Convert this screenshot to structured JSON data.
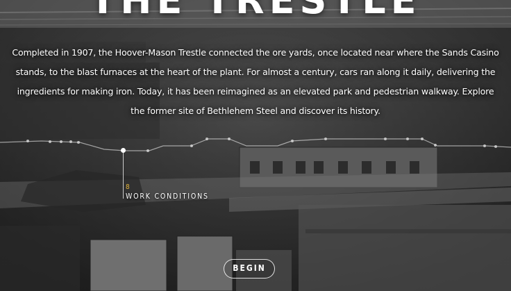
{
  "hero": {
    "title": "THE TRESTLE",
    "intro": "Completed in 1907, the Hoover-Mason Trestle connected the ore yards, once located near where the Sands Casino stands, to the blast furnaces at the heart of the plant. For almost a century, cars ran along it daily, delivering the ingredients for making iron. Today, it has been reimagined as an elevated park and pedestrian walkway. Explore the former site of Bethlehem Steel and discover its history."
  },
  "map_marker": {
    "number": "8",
    "label": "WORK CONDITIONS"
  },
  "begin_button": {
    "label": "BEGIN"
  },
  "colors": {
    "accent_number": "#e2b43a",
    "text": "#ffffff"
  }
}
